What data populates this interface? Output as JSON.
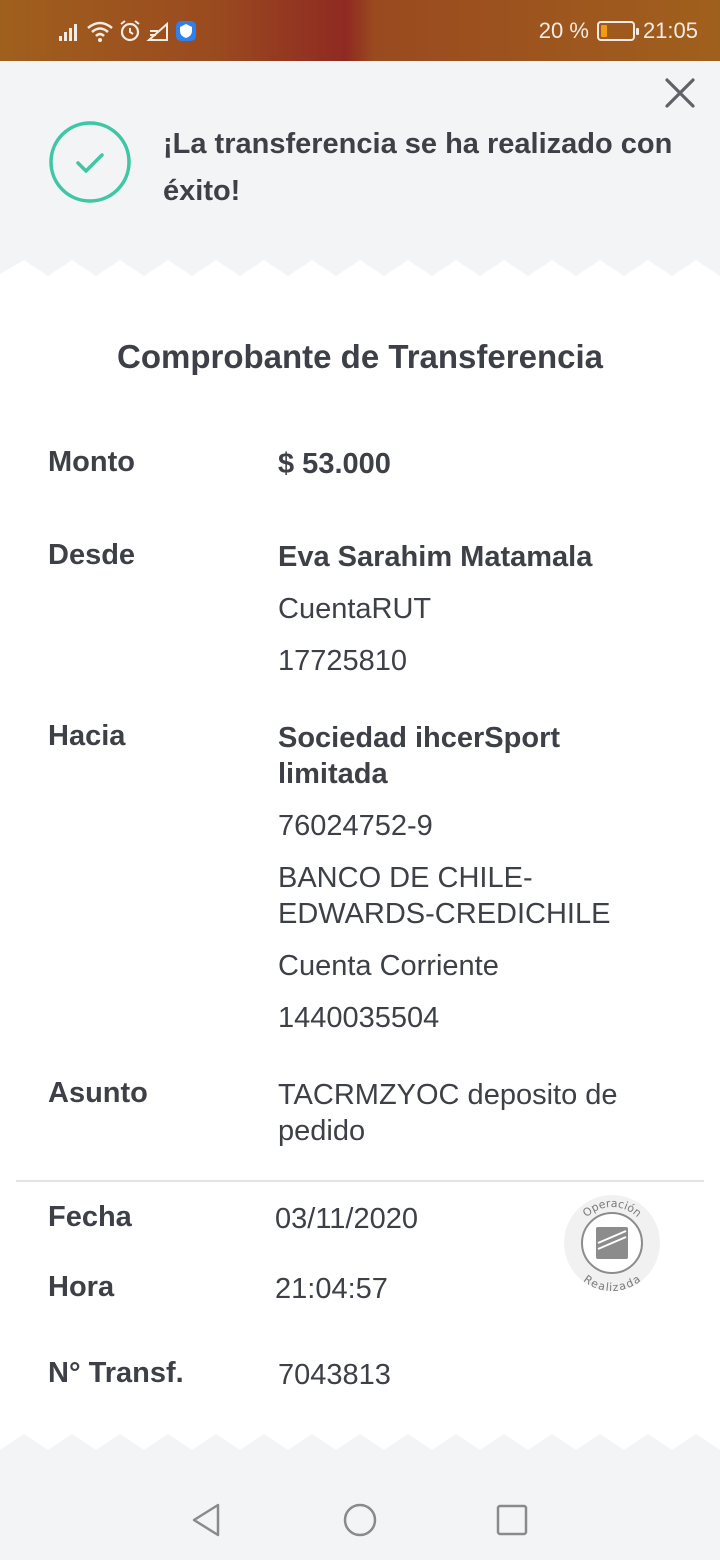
{
  "status_bar": {
    "battery_text": "20 %",
    "battery_level": 0.2,
    "time": "21:05",
    "icons": [
      "signal-icon",
      "wifi-icon",
      "alarm-icon",
      "data-icon",
      "shield-icon"
    ]
  },
  "header": {
    "success_message": "¡La transferencia se ha realizado con éxito!",
    "close_icon": "close-icon",
    "check_icon": "check-circle-icon",
    "accent_color": "#3ec6a5"
  },
  "receipt": {
    "title": "Comprobante de Transferencia",
    "monto": {
      "label": "Monto",
      "value": "$ 53.000"
    },
    "desde": {
      "label": "Desde",
      "name": "Eva Sarahim Matamala",
      "account_type": "CuentaRUT",
      "account_number": "17725810"
    },
    "hacia": {
      "label": "Hacia",
      "name": "Sociedad ihcerSport limitada",
      "rut": "76024752-9",
      "bank": "BANCO DE CHILE-EDWARDS-CREDICHILE",
      "account_type": "Cuenta Corriente",
      "account_number": "1440035504"
    },
    "asunto": {
      "label": "Asunto",
      "value": "TACRMZYOC deposito de pedido"
    },
    "fecha": {
      "label": "Fecha",
      "value": "03/11/2020"
    },
    "hora": {
      "label": "Hora",
      "value": "21:04:57"
    },
    "transf": {
      "label": "N° Transf.",
      "value": "7043813"
    },
    "stamp": {
      "top_text": "Operación",
      "bottom_text": "Realizada"
    }
  },
  "nav_bar": {
    "back_icon": "back-triangle-icon",
    "home_icon": "home-circle-icon",
    "recents_icon": "recents-square-icon"
  }
}
